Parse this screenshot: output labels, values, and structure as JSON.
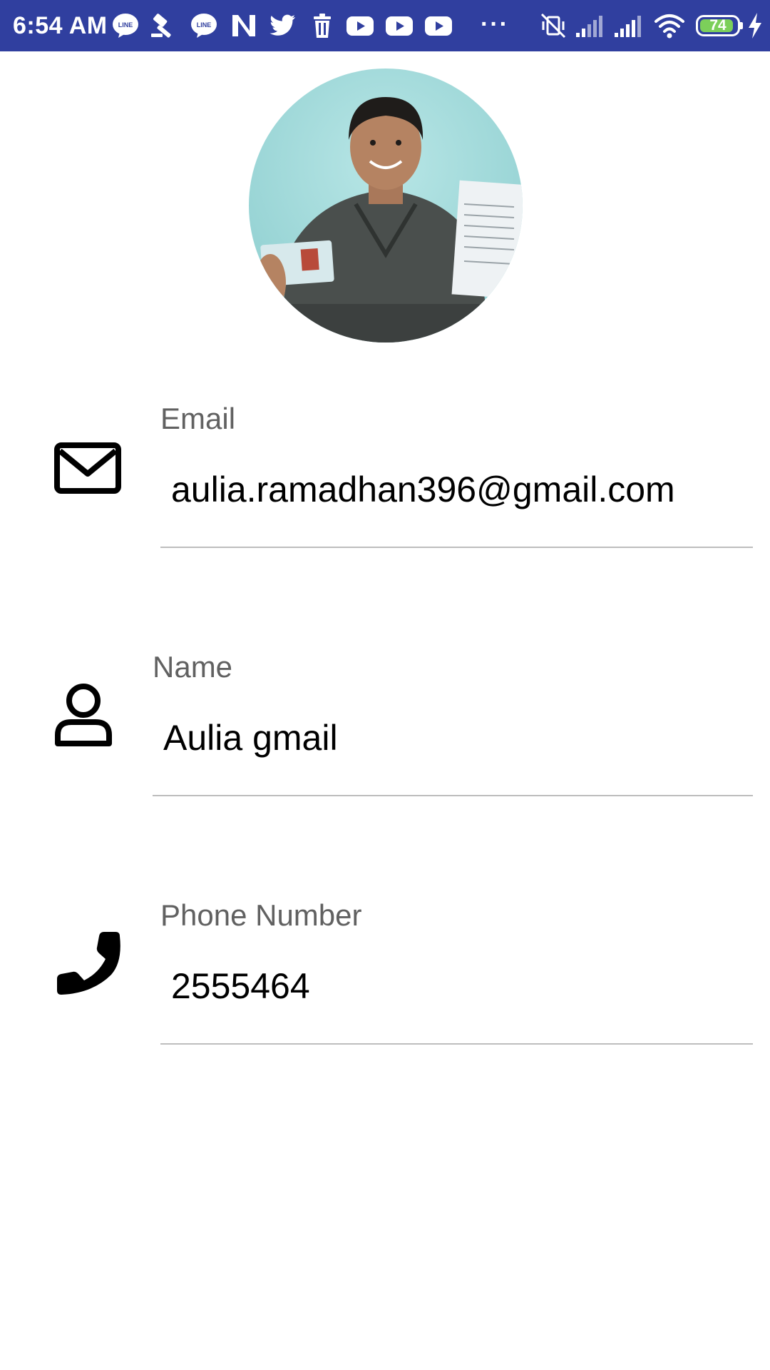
{
  "status_bar": {
    "time": "6:54 AM",
    "notification_icons": [
      "line-icon",
      "hammer-icon",
      "line-icon",
      "n-app-icon",
      "twitter-icon",
      "trash-icon",
      "youtube-icon",
      "youtube-icon",
      "youtube-icon",
      "more-dots-icon"
    ],
    "more_label": "···",
    "battery_level": "74",
    "icons": [
      "vibrate-off-icon",
      "signal-icon",
      "signal-icon",
      "wifi-icon",
      "battery-icon",
      "charging-icon"
    ],
    "background_color": "#303F9F"
  },
  "profile": {
    "avatar": "profile-photo"
  },
  "fields": {
    "email": {
      "label": "Email",
      "value": "aulia.ramadhan396@gmail.com",
      "icon": "envelope-icon"
    },
    "name": {
      "label": "Name",
      "value": "Aulia gmail",
      "icon": "person-icon"
    },
    "phone": {
      "label": "Phone Number",
      "value": "2555464",
      "icon": "phone-icon"
    }
  }
}
